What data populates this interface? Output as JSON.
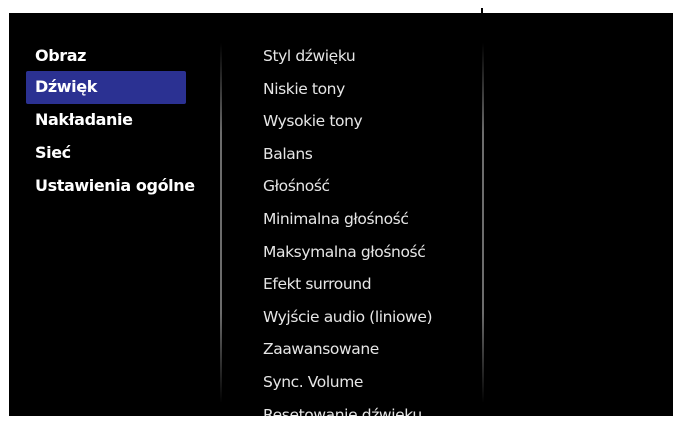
{
  "menu": {
    "categories": [
      {
        "label": "Obraz"
      },
      {
        "label": "Dźwięk"
      },
      {
        "label": "Nakładanie"
      },
      {
        "label": "Sieć"
      },
      {
        "label": "Ustawienia ogólne"
      }
    ],
    "selected_category": "Dźwięk",
    "settings": [
      {
        "label": "Styl dźwięku"
      },
      {
        "label": "Niskie tony"
      },
      {
        "label": "Wysokie tony"
      },
      {
        "label": "Balans"
      },
      {
        "label": "Głośność"
      },
      {
        "label": "Minimalna głośność"
      },
      {
        "label": "Maksymalna głośność"
      },
      {
        "label": "Efekt surround"
      },
      {
        "label": "Wyjście audio (liniowe)"
      },
      {
        "label": "Zaawansowane"
      },
      {
        "label": "Sync. Volume"
      },
      {
        "label": "Resetowanie dźwięku"
      }
    ]
  },
  "colors": {
    "background": "#000000",
    "highlight": "#2b3192",
    "text": "#ffffff"
  }
}
